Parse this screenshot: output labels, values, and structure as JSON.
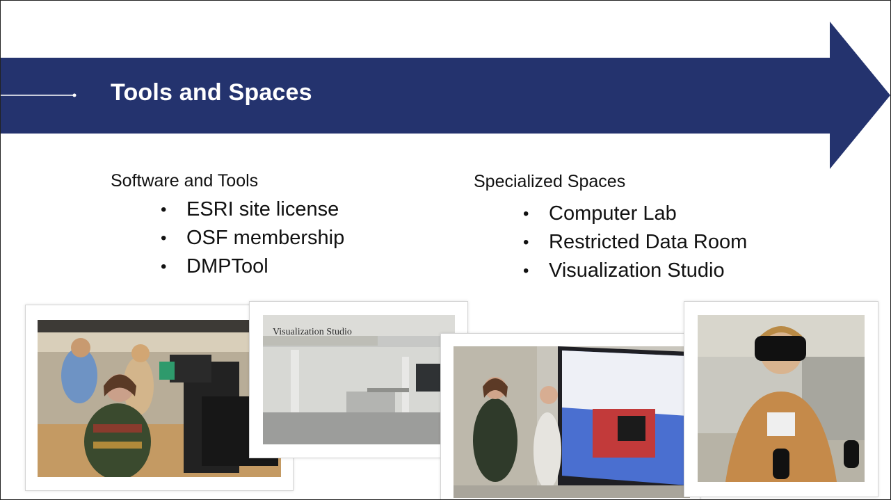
{
  "header": {
    "title": "Tools and Spaces"
  },
  "software": {
    "heading": "Software and Tools",
    "items": [
      "ESRI site license",
      "OSF membership",
      "DMPTool"
    ]
  },
  "spaces": {
    "heading": "Specialized Spaces",
    "items": [
      "Computer Lab",
      "Restricted Data Room",
      "Visualization Studio"
    ]
  },
  "photos": {
    "studio_sign": "Visualization Studio"
  },
  "colors": {
    "banner": "#24336e",
    "text": "#111111"
  }
}
